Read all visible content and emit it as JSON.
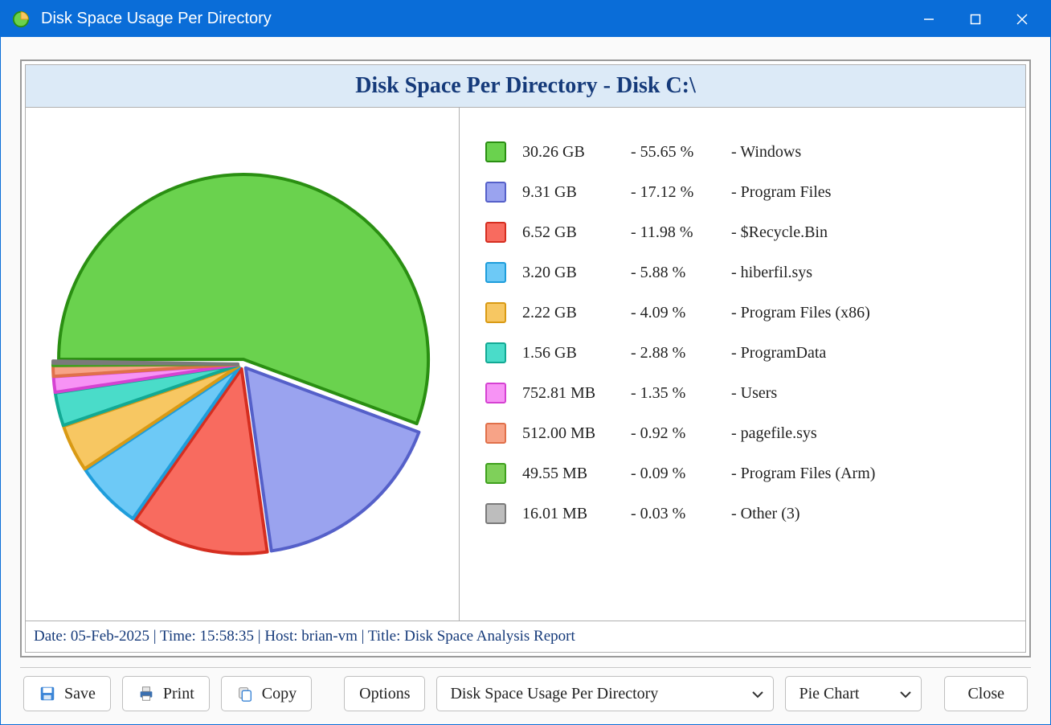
{
  "window": {
    "title": "Disk Space Usage Per Directory"
  },
  "chart_data": {
    "type": "pie",
    "title": "Disk Space Per Directory - Disk C:\\",
    "series": [
      {
        "name": "Windows",
        "size": "30.26 GB",
        "percent": 55.65,
        "color_fill": "#6ad24e",
        "color_stroke": "#2a8f12"
      },
      {
        "name": "Program Files",
        "size": "9.31 GB",
        "percent": 17.12,
        "color_fill": "#9aa3ef",
        "color_stroke": "#5560c9"
      },
      {
        "name": "$Recycle.Bin",
        "size": "6.52 GB",
        "percent": 11.98,
        "color_fill": "#f86b5f",
        "color_stroke": "#d52e20"
      },
      {
        "name": "hiberfil.sys",
        "size": "3.20 GB",
        "percent": 5.88,
        "color_fill": "#6dc9f6",
        "color_stroke": "#1e9ddb"
      },
      {
        "name": "Program Files (x86)",
        "size": "2.22 GB",
        "percent": 4.09,
        "color_fill": "#f7c762",
        "color_stroke": "#d99a14"
      },
      {
        "name": "ProgramData",
        "size": "1.56 GB",
        "percent": 2.88,
        "color_fill": "#4adcc9",
        "color_stroke": "#12a994"
      },
      {
        "name": "Users",
        "size": "752.81 MB",
        "percent": 1.35,
        "color_fill": "#f793f5",
        "color_stroke": "#d542d2"
      },
      {
        "name": "pagefile.sys",
        "size": "512.00 MB",
        "percent": 0.92,
        "color_fill": "#f7a387",
        "color_stroke": "#e0704a"
      },
      {
        "name": "Program Files (Arm)",
        "size": "49.55 MB",
        "percent": 0.09,
        "color_fill": "#7fd05a",
        "color_stroke": "#3fa01e"
      },
      {
        "name": "Other (3)",
        "size": "16.01 MB",
        "percent": 0.03,
        "color_fill": "#bdbdbd",
        "color_stroke": "#7a7a7a"
      }
    ]
  },
  "footer": {
    "text": "Date: 05-Feb-2025 | Time: 15:58:35 | Host: brian-vm | Title: Disk Space Analysis Report"
  },
  "toolbar": {
    "save": "Save",
    "print": "Print",
    "copy": "Copy",
    "options": "Options",
    "select_report": "Disk Space Usage Per Directory",
    "select_chart": "Pie Chart",
    "close": "Close"
  }
}
